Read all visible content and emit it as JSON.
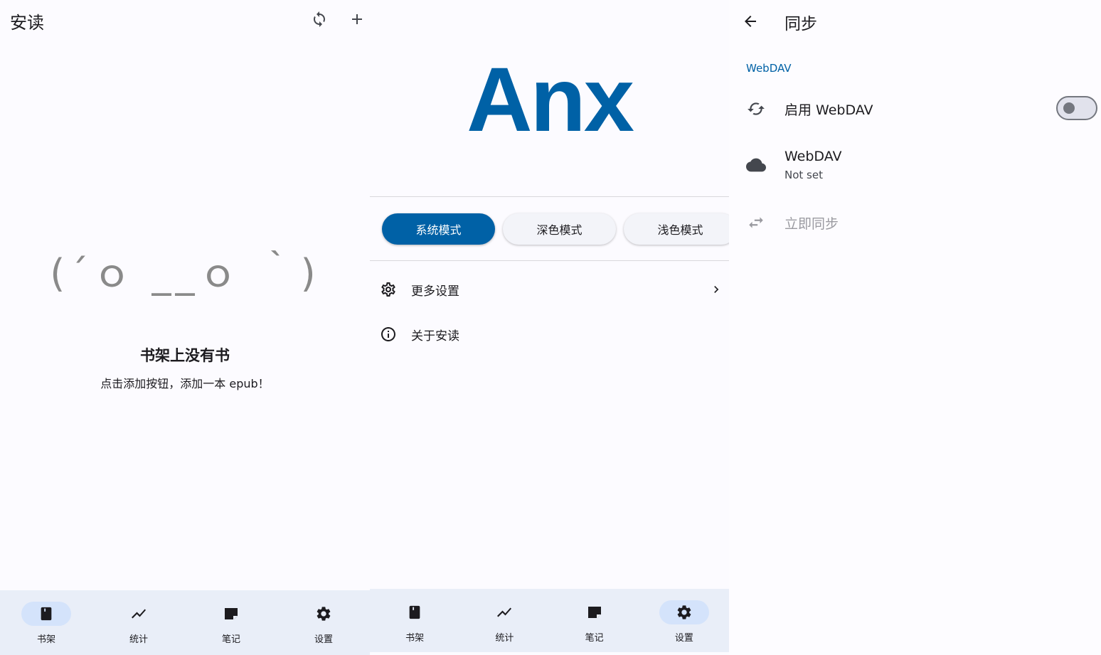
{
  "panel1": {
    "title": "安读",
    "kaomoji": "(´ｏ __ｏ ｀)",
    "empty_title": "书架上没有书",
    "empty_subtitle": "点击添加按钮，添加一本 epub！",
    "actions": [
      "sync-icon",
      "add-icon"
    ]
  },
  "nav": {
    "items": [
      {
        "label": "书架",
        "icon": "bookshelf-icon"
      },
      {
        "label": "统计",
        "icon": "statistics-icon"
      },
      {
        "label": "笔记",
        "icon": "notes-icon"
      },
      {
        "label": "设置",
        "icon": "settings-icon"
      }
    ],
    "panel1_active": "书架",
    "panel2_active": "设置"
  },
  "panel2": {
    "logo": "Anx",
    "theme_modes": [
      {
        "label": "系统模式",
        "selected": true
      },
      {
        "label": "深色模式",
        "selected": false
      },
      {
        "label": "浅色模式",
        "selected": false
      }
    ],
    "items": [
      {
        "label": "更多设置",
        "icon": "gear-icon",
        "chevron": true
      },
      {
        "label": "关于安读",
        "icon": "info-icon",
        "chevron": false
      }
    ]
  },
  "panel3": {
    "title": "同步",
    "section_header": "WebDAV",
    "enable_webdav": {
      "label": "启用 WebDAV",
      "enabled": false
    },
    "webdav": {
      "title": "WebDAV",
      "subtitle": "Not set"
    },
    "sync_now": {
      "label": "立即同步",
      "disabled": true
    }
  },
  "colors": {
    "primary": "#0061a6",
    "nav_bg": "#e9eef8",
    "nav_active_pill": "#d4e3fb",
    "text": "#1c1b1f",
    "muted": "#9a9aa0"
  }
}
